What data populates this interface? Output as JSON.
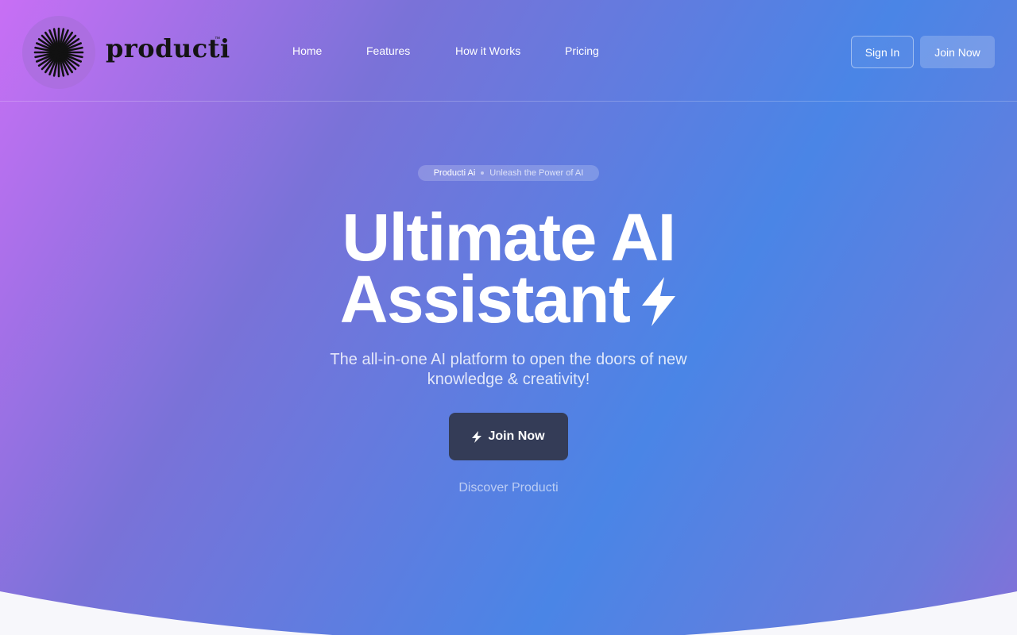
{
  "brand": {
    "name": "producti",
    "trademark": "™",
    "logo_icon": "starburst-icon"
  },
  "nav": {
    "items": [
      {
        "label": "Home"
      },
      {
        "label": "Features"
      },
      {
        "label": "How it Works"
      },
      {
        "label": "Pricing"
      }
    ]
  },
  "header_actions": {
    "sign_in": "Sign In",
    "join_now": "Join Now"
  },
  "hero": {
    "pill_brand": "Producti Ai",
    "pill_tagline": "Unleash the Power of AI",
    "headline_line1": "Ultimate AI",
    "headline_line2": "Assistant",
    "headline_icon": "lightning-bolt-icon",
    "subtitle": "The all-in-one AI platform to open the doors of new knowledge & creativity!",
    "cta_label": "Join Now",
    "cta_icon": "lightning-bolt-icon",
    "secondary_link": "Discover Producti"
  },
  "colors": {
    "gradient_start": "#c86ff5",
    "gradient_mid": "#4a85e6",
    "cta_background": "#343c57",
    "logo_text": "#141414",
    "footer_background": "#f7f7fb"
  }
}
